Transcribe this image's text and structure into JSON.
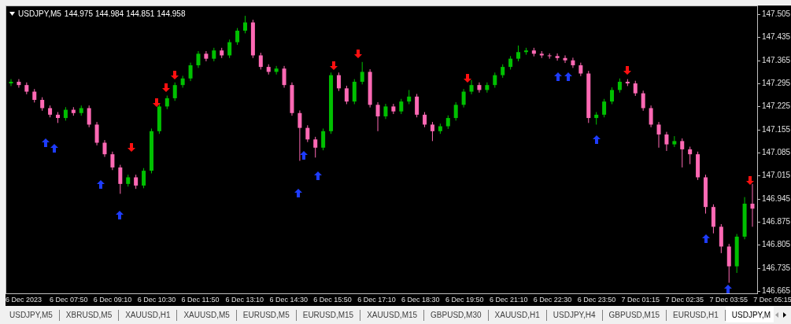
{
  "chart": {
    "symbol": "USDJPY,M5",
    "quotes": [
      "144.975",
      "144.984",
      "144.851",
      "144.958"
    ],
    "chart_data": {
      "type": "candlestick",
      "ylim": [
        146.658,
        147.529
      ],
      "categories": [
        null,
        null,
        null,
        null,
        null,
        null,
        null,
        null,
        null,
        null,
        null,
        null,
        null,
        null,
        null,
        null,
        null,
        null,
        null,
        null,
        null,
        null,
        null,
        null,
        null,
        null,
        null,
        null,
        null,
        null,
        null,
        null,
        null,
        null,
        null,
        null,
        null,
        null,
        null,
        null,
        null,
        null,
        null,
        null,
        null,
        null,
        null,
        null,
        null,
        null,
        null,
        null,
        null,
        null,
        null,
        null,
        null,
        null,
        null,
        null,
        null,
        null,
        null,
        null,
        null,
        null,
        null,
        null,
        null,
        null,
        null,
        null,
        null,
        null,
        null,
        null,
        null,
        null,
        null,
        null,
        null,
        null,
        null,
        null,
        null,
        null,
        null,
        null,
        null,
        null,
        null,
        null,
        null,
        null,
        null,
        null
      ],
      "yticks": [
        {
          "value": 147.505,
          "label": "147.505"
        },
        {
          "value": 147.435,
          "label": "147.435"
        },
        {
          "value": 147.365,
          "label": "147.365"
        },
        {
          "value": 147.295,
          "label": "147.295"
        },
        {
          "value": 147.225,
          "label": "147.225"
        },
        {
          "value": 147.155,
          "label": "147.155"
        },
        {
          "value": 147.085,
          "label": "147.085"
        },
        {
          "value": 147.015,
          "label": "147.015"
        },
        {
          "value": 146.945,
          "label": "146.945"
        },
        {
          "value": 146.875,
          "label": "146.875"
        },
        {
          "value": 146.805,
          "label": "146.805"
        },
        {
          "value": 146.735,
          "label": "146.735"
        },
        {
          "value": 146.665,
          "label": "146.665"
        }
      ],
      "ohlc": [
        [
          147.295,
          147.308,
          147.287,
          147.3
        ],
        [
          147.3,
          147.308,
          147.282,
          147.29
        ],
        [
          147.29,
          147.298,
          147.262,
          147.27
        ],
        [
          147.27,
          147.278,
          147.237,
          147.245
        ],
        [
          147.245,
          147.253,
          147.212,
          147.22
        ],
        [
          147.22,
          147.228,
          147.192,
          147.2
        ],
        [
          147.2,
          147.208,
          147.175,
          147.19
        ],
        [
          147.19,
          147.223,
          147.182,
          147.215
        ],
        [
          147.215,
          147.223,
          147.197,
          147.205
        ],
        [
          147.205,
          147.228,
          147.197,
          147.22
        ],
        [
          147.22,
          147.228,
          147.162,
          147.17
        ],
        [
          147.17,
          147.178,
          147.107,
          147.115
        ],
        [
          147.115,
          147.123,
          147.072,
          147.08
        ],
        [
          147.08,
          147.088,
          147.032,
          147.04
        ],
        [
          147.04,
          147.048,
          146.96,
          146.99
        ],
        [
          146.99,
          147.018,
          146.982,
          147.01
        ],
        [
          147.01,
          147.018,
          146.975,
          146.985
        ],
        [
          146.985,
          147.038,
          146.977,
          147.03
        ],
        [
          147.03,
          147.158,
          147.022,
          147.15
        ],
        [
          147.15,
          147.233,
          147.142,
          147.225
        ],
        [
          147.225,
          147.258,
          147.217,
          147.25
        ],
        [
          147.25,
          147.298,
          147.242,
          147.29
        ],
        [
          147.29,
          147.318,
          147.282,
          147.31
        ],
        [
          147.31,
          147.358,
          147.302,
          147.35
        ],
        [
          147.35,
          147.393,
          147.342,
          147.385
        ],
        [
          147.385,
          147.393,
          147.362,
          147.37
        ],
        [
          147.37,
          147.403,
          147.362,
          147.395
        ],
        [
          147.395,
          147.403,
          147.372,
          147.38
        ],
        [
          147.38,
          147.428,
          147.372,
          147.42
        ],
        [
          147.42,
          147.463,
          147.412,
          147.455
        ],
        [
          147.455,
          147.5,
          147.447,
          147.48
        ],
        [
          147.48,
          147.488,
          147.372,
          147.38
        ],
        [
          147.38,
          147.388,
          147.337,
          147.345
        ],
        [
          147.345,
          147.353,
          147.322,
          147.33
        ],
        [
          147.33,
          147.348,
          147.322,
          147.34
        ],
        [
          147.34,
          147.348,
          147.282,
          147.29
        ],
        [
          147.29,
          147.298,
          147.197,
          147.205
        ],
        [
          147.205,
          147.213,
          147.06,
          147.16
        ],
        [
          147.16,
          147.168,
          147.117,
          147.125
        ],
        [
          147.125,
          147.133,
          147.07,
          147.1
        ],
        [
          147.1,
          147.158,
          147.092,
          147.15
        ],
        [
          147.15,
          147.328,
          147.142,
          147.32
        ],
        [
          147.32,
          147.328,
          147.272,
          147.28
        ],
        [
          147.28,
          147.288,
          147.232,
          147.24
        ],
        [
          147.24,
          147.308,
          147.232,
          147.3
        ],
        [
          147.3,
          147.36,
          147.292,
          147.33
        ],
        [
          147.33,
          147.338,
          147.222,
          147.23
        ],
        [
          147.23,
          147.238,
          147.15,
          147.195
        ],
        [
          147.195,
          147.233,
          147.187,
          147.225
        ],
        [
          147.225,
          147.233,
          147.202,
          147.21
        ],
        [
          147.21,
          147.248,
          147.202,
          147.24
        ],
        [
          147.24,
          147.275,
          147.232,
          147.255
        ],
        [
          147.255,
          147.263,
          147.192,
          147.2
        ],
        [
          147.2,
          147.208,
          147.162,
          147.17
        ],
        [
          147.17,
          147.178,
          147.12,
          147.15
        ],
        [
          147.15,
          147.173,
          147.142,
          147.165
        ],
        [
          147.165,
          147.198,
          147.157,
          147.19
        ],
        [
          147.19,
          147.238,
          147.182,
          147.23
        ],
        [
          147.23,
          147.278,
          147.222,
          147.27
        ],
        [
          147.27,
          147.305,
          147.262,
          147.29
        ],
        [
          147.29,
          147.298,
          147.267,
          147.275
        ],
        [
          147.275,
          147.298,
          147.267,
          147.29
        ],
        [
          147.29,
          147.328,
          147.282,
          147.32
        ],
        [
          147.32,
          147.353,
          147.312,
          147.345
        ],
        [
          147.345,
          147.378,
          147.337,
          147.37
        ],
        [
          147.37,
          147.41,
          147.362,
          147.39
        ],
        [
          147.39,
          147.403,
          147.382,
          147.395
        ],
        [
          147.395,
          147.403,
          147.377,
          147.385
        ],
        [
          147.385,
          147.393,
          147.372,
          147.38
        ],
        [
          147.38,
          147.386,
          147.37,
          147.378
        ],
        [
          147.378,
          147.386,
          147.364,
          147.372
        ],
        [
          147.372,
          147.38,
          147.357,
          147.365
        ],
        [
          147.365,
          147.373,
          147.342,
          147.35
        ],
        [
          147.35,
          147.358,
          147.317,
          147.325
        ],
        [
          147.325,
          147.333,
          147.175,
          147.19
        ],
        [
          147.19,
          147.208,
          147.17,
          147.2
        ],
        [
          147.2,
          147.248,
          147.192,
          147.24
        ],
        [
          147.24,
          147.283,
          147.232,
          147.275
        ],
        [
          147.275,
          147.31,
          147.267,
          147.3
        ],
        [
          147.3,
          147.308,
          147.287,
          147.295
        ],
        [
          147.295,
          147.303,
          147.257,
          147.265
        ],
        [
          147.265,
          147.273,
          147.212,
          147.22
        ],
        [
          147.22,
          147.228,
          147.162,
          147.17
        ],
        [
          147.17,
          147.178,
          147.1,
          147.14
        ],
        [
          147.14,
          147.148,
          147.09,
          147.11
        ],
        [
          147.11,
          147.135,
          147.102,
          147.12
        ],
        [
          147.12,
          147.128,
          147.04,
          147.095
        ],
        [
          147.095,
          147.103,
          147.05,
          147.08
        ],
        [
          147.08,
          147.088,
          147.002,
          147.01
        ],
        [
          147.01,
          147.018,
          146.9,
          146.92
        ],
        [
          146.92,
          146.928,
          146.84,
          146.86
        ],
        [
          146.86,
          146.868,
          146.78,
          146.8
        ],
        [
          146.8,
          146.808,
          146.69,
          146.74
        ],
        [
          146.74,
          146.838,
          146.72,
          146.83
        ],
        [
          146.83,
          146.95,
          146.822,
          146.93
        ],
        [
          146.93,
          146.99,
          146.86,
          146.915
        ]
      ]
    }
  },
  "time_axis": [
    "6 Dec 2023",
    "6 Dec 07:50",
    "6 Dec 09:10",
    "6 Dec 10:30",
    "6 Dec 11:50",
    "6 Dec 13:10",
    "6 Dec 14:30",
    "6 Dec 15:50",
    "6 Dec 17:10",
    "6 Dec 18:30",
    "6 Dec 19:50",
    "6 Dec 21:10",
    "6 Dec 22:30",
    "6 Dec 23:50",
    "7 Dec 01:15",
    "7 Dec 02:35",
    "7 Dec 03:55",
    "7 Dec 05:15"
  ],
  "tabs": [
    {
      "label": "USDJPY,M5",
      "selected": false
    },
    {
      "label": "XBRUSD,M5",
      "selected": false
    },
    {
      "label": "XAUUSD,H1",
      "selected": false
    },
    {
      "label": "XAUUSD,M5",
      "selected": false
    },
    {
      "label": "EURUSD,M5",
      "selected": false
    },
    {
      "label": "EURUSD,M15",
      "selected": false
    },
    {
      "label": "XAUUSD,M15",
      "selected": false
    },
    {
      "label": "GBPUSD,M30",
      "selected": false
    },
    {
      "label": "XAUUSD,H1",
      "selected": false
    },
    {
      "label": "USDJPY,H4",
      "selected": false
    },
    {
      "label": "GBPUSD,M15",
      "selected": false
    },
    {
      "label": "EURUSD,H1",
      "selected": false
    },
    {
      "label": "USDJPY,M",
      "selected": true
    }
  ]
}
